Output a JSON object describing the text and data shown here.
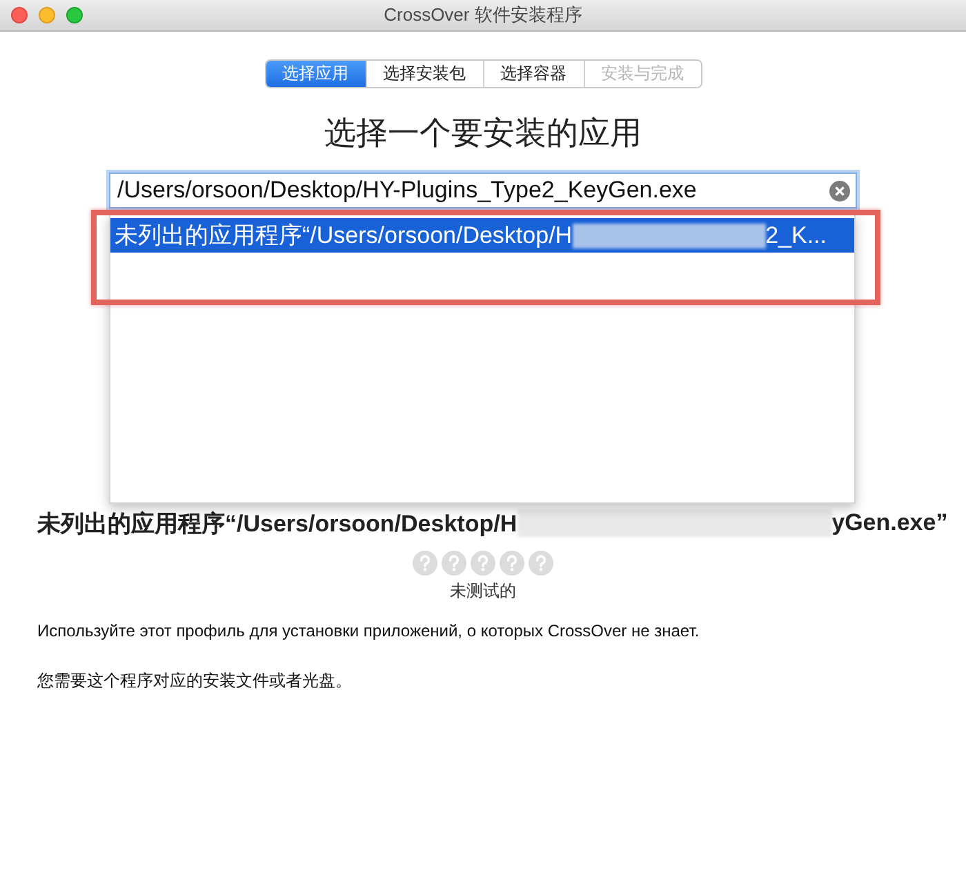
{
  "window": {
    "title": "CrossOver 软件安装程序"
  },
  "steps": [
    {
      "label": "选择应用",
      "selected": true,
      "disabled": false
    },
    {
      "label": "选择安装包",
      "selected": false,
      "disabled": false
    },
    {
      "label": "选择容器",
      "selected": false,
      "disabled": false
    },
    {
      "label": "安装与完成",
      "selected": false,
      "disabled": true
    }
  ],
  "heading": "选择一个要安装的应用",
  "search": {
    "value": "/Users/orsoon/Desktop/HY-Plugins_Type2_KeyGen.exe"
  },
  "suggestions": [
    {
      "text_before": "未列出的应用程序“/Users/orsoon/Desktop/H",
      "text_after": "2_K...",
      "selected": true
    }
  ],
  "app": {
    "name_before": "未列出的应用程序“/Users/orsoon/Desktop/H",
    "name_after": "yGen.exe”",
    "ratings": [
      {
        "kind": "untested"
      },
      {
        "kind": "untested"
      },
      {
        "kind": "untested"
      },
      {
        "kind": "untested"
      },
      {
        "kind": "untested"
      }
    ],
    "rating_label": "未测试的",
    "description": "Используйте этот профиль для установки приложений, о которых CrossOver не знает.",
    "note": "您需要这个程序对应的安装文件或者光盘。"
  }
}
